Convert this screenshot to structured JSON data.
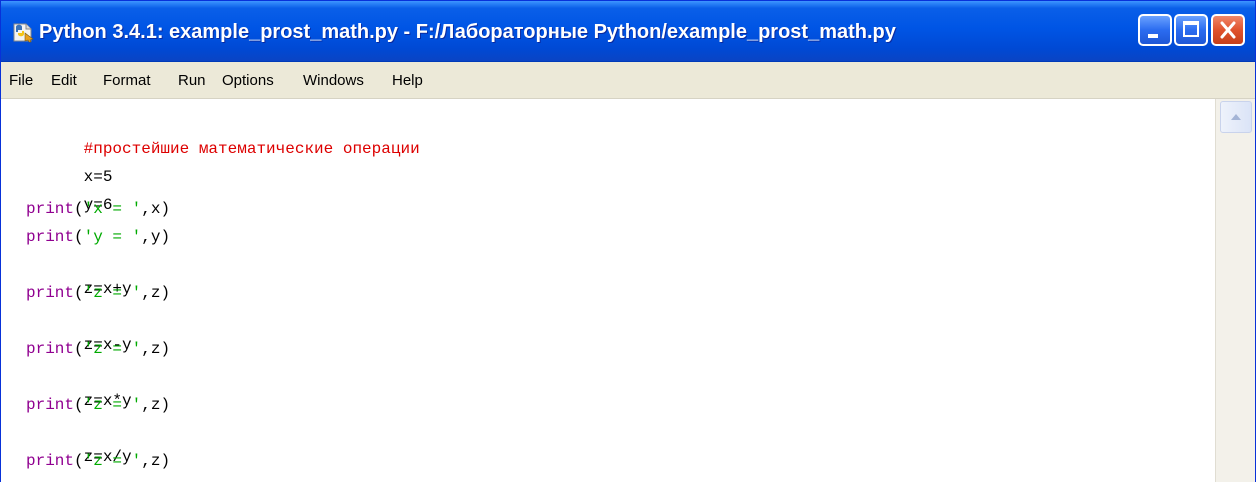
{
  "window": {
    "title": "Python 3.4.1: example_prost_math.py - F:/Лабораторные Python/example_prost_math.py",
    "icon": "python-file-icon",
    "controls": [
      "minimize-icon",
      "maximize-icon",
      "close-icon"
    ],
    "colors": {
      "titlebar": "#0055e5",
      "close": "#e0522d"
    }
  },
  "menu": {
    "file": "File",
    "edit": "Edit",
    "format": "Format",
    "run": "Run",
    "options": "Options",
    "windows": "Windows",
    "help": "Help"
  },
  "code": {
    "comment": "#простейшие математические операции",
    "l2": "x=5",
    "l3": "y=6",
    "l4_fn": "print",
    "l4_a": "(",
    "l4_str": "'x = '",
    "l4_b": ",x)",
    "l5_fn": "print",
    "l5_a": "(",
    "l5_str": "'y = '",
    "l5_b": ",y)",
    "l6": "z=x+y",
    "l7_fn": "print",
    "l7_a": "(",
    "l7_str": "'z = '",
    "l7_b": ",z)",
    "l8": "z=x-y",
    "l9_fn": "print",
    "l9_a": "(",
    "l9_str": "'z = '",
    "l9_b": ",z)",
    "l10": "z=x*y",
    "l11_fn": "print",
    "l11_a": "(",
    "l11_str": "'z = '",
    "l11_b": ",z)",
    "l12": "z=x/y",
    "l13_fn": "print",
    "l13_a": "(",
    "l13_str": "'z = '",
    "l13_b": ",z)",
    "colors": {
      "comment": "#dd0000",
      "builtin": "#900090",
      "string": "#00aa00"
    }
  }
}
